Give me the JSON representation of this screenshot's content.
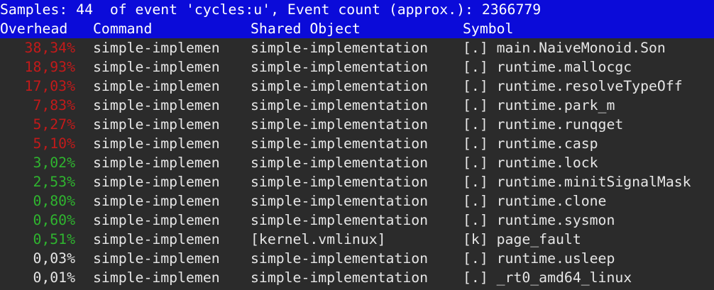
{
  "title": "Samples: 44  of event 'cycles:u', Event count (approx.): 2366779",
  "headers": {
    "overhead": "Overhead",
    "command": "Command",
    "shared_object": "Shared Object",
    "symbol": "Symbol"
  },
  "colors": {
    "header_bg": "#0b0bd9",
    "high": "#c31a1a",
    "medium": "#2fb52f",
    "low": "#e6e6e6"
  },
  "rows": [
    {
      "overhead": "38,34%",
      "level": "high",
      "command": "simple-implemen",
      "dso": "simple-implementation",
      "symbol": "[.] main.NaiveMonoid.Son"
    },
    {
      "overhead": "18,93%",
      "level": "high",
      "command": "simple-implemen",
      "dso": "simple-implementation",
      "symbol": "[.] runtime.mallocgc"
    },
    {
      "overhead": "17,03%",
      "level": "high",
      "command": "simple-implemen",
      "dso": "simple-implementation",
      "symbol": "[.] runtime.resolveTypeOff"
    },
    {
      "overhead": "7,83%",
      "level": "high",
      "command": "simple-implemen",
      "dso": "simple-implementation",
      "symbol": "[.] runtime.park_m"
    },
    {
      "overhead": "5,27%",
      "level": "high",
      "command": "simple-implemen",
      "dso": "simple-implementation",
      "symbol": "[.] runtime.runqget"
    },
    {
      "overhead": "5,10%",
      "level": "high",
      "command": "simple-implemen",
      "dso": "simple-implementation",
      "symbol": "[.] runtime.casp"
    },
    {
      "overhead": "3,02%",
      "level": "medium",
      "command": "simple-implemen",
      "dso": "simple-implementation",
      "symbol": "[.] runtime.lock"
    },
    {
      "overhead": "2,53%",
      "level": "medium",
      "command": "simple-implemen",
      "dso": "simple-implementation",
      "symbol": "[.] runtime.minitSignalMask"
    },
    {
      "overhead": "0,80%",
      "level": "medium",
      "command": "simple-implemen",
      "dso": "simple-implementation",
      "symbol": "[.] runtime.clone"
    },
    {
      "overhead": "0,60%",
      "level": "medium",
      "command": "simple-implemen",
      "dso": "simple-implementation",
      "symbol": "[.] runtime.sysmon"
    },
    {
      "overhead": "0,51%",
      "level": "medium",
      "command": "simple-implemen",
      "dso": "[kernel.vmlinux]",
      "symbol": "[k] page_fault"
    },
    {
      "overhead": "0,03%",
      "level": "low",
      "command": "simple-implemen",
      "dso": "simple-implementation",
      "symbol": "[.] runtime.usleep"
    },
    {
      "overhead": "0,01%",
      "level": "low",
      "command": "simple-implemen",
      "dso": "simple-implementation",
      "symbol": "[.] _rt0_amd64_linux"
    }
  ]
}
